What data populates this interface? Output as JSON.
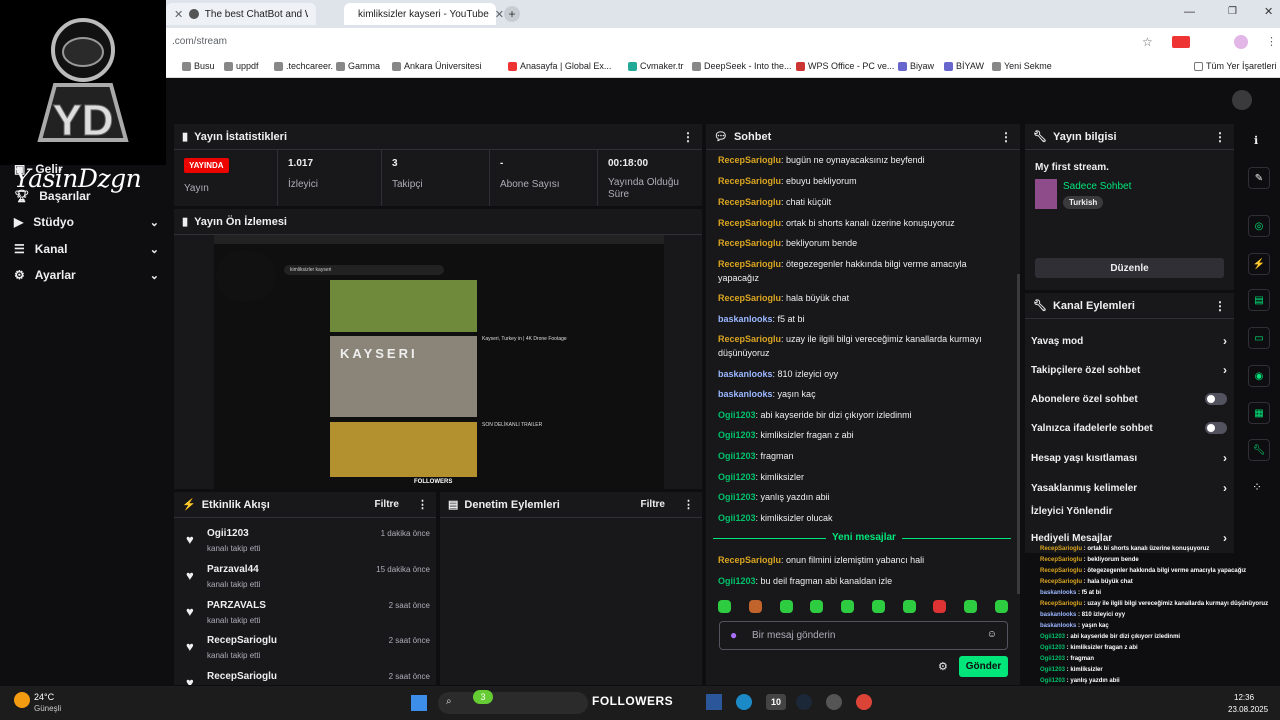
{
  "browser": {
    "tabs": [
      {
        "label": "The best ChatBot and Widgets"
      },
      {
        "label": "kimliksizler kayseri - YouTube"
      }
    ],
    "url": ".com/stream",
    "bookmarks": [
      "Busu",
      "uppdf",
      ".techcareer.",
      "Gamma",
      "Ankara Üniversitesi",
      "Anasayfa | Global Ex...",
      "Cvmaker.tr",
      "DeepSeek - Into the...",
      "WPS Office - PC ve...",
      "Biyaw",
      "BİYAW",
      "Yeni Sekme",
      "Tüm Yer İşaretleri"
    ]
  },
  "brand": {
    "name": "YasinDzgn",
    "logo_text": "YD"
  },
  "nav": [
    {
      "label": "Gelir",
      "icon": "money-icon"
    },
    {
      "label": "Başarılar",
      "icon": "trophy-icon"
    },
    {
      "label": "Stüdyo",
      "icon": "studio-icon"
    },
    {
      "label": "Kanal",
      "icon": "channel-icon"
    },
    {
      "label": "Ayarlar",
      "icon": "gear-icon"
    }
  ],
  "stats": {
    "title": "Yayın İstatistikleri",
    "live_badge": "YAYINDA",
    "live_label": "Yayın",
    "viewers_value": "1.017",
    "viewers_label": "İzleyici",
    "followers_value": "3",
    "followers_label": "Takipçi",
    "subs_value": "-",
    "subs_label": "Abone Sayısı",
    "time_value": "00:18:00",
    "time_label": "Yayında Olduğu Süre"
  },
  "preview": {
    "title": "Yayın Ön İzlemesi",
    "search_text": "kimliksizler kayseri",
    "video_title_1": "KAYSERI",
    "video_desc_1": "Kayseri, Turkey in | 4K Drone Footage",
    "video_title_2": "SON DELİKANLI TRAILER",
    "followers_overlay": "FOLLOWERS"
  },
  "activity": {
    "title": "Etkinlik Akışı",
    "filter": "Filtre",
    "items": [
      {
        "name": "Ogii1203",
        "sub": "kanalı takip etti",
        "time": "1 dakika önce"
      },
      {
        "name": "Parzaval44",
        "sub": "kanalı takip etti",
        "time": "15 dakika önce"
      },
      {
        "name": "PARZAVALS",
        "sub": "kanalı takip etti",
        "time": "2 saat önce"
      },
      {
        "name": "RecepSarioglu",
        "sub": "kanalı takip etti",
        "time": "2 saat önce"
      },
      {
        "name": "RecepSarioglu",
        "sub": "",
        "time": "2 saat önce"
      }
    ]
  },
  "moderation": {
    "title": "Denetim Eylemleri",
    "filter": "Filtre"
  },
  "chat": {
    "title": "Sohbet",
    "messages": [
      {
        "user": "RecepSarioglu",
        "text": "bugün ne oynayacaksınız beyfendi",
        "c": "u1"
      },
      {
        "user": "RecepSarioglu",
        "text": "ebuyu bekliyorum",
        "c": "u1"
      },
      {
        "user": "RecepSarioglu",
        "text": "chati küçült",
        "c": "u1"
      },
      {
        "user": "RecepSarioglu",
        "text": "ortak bi shorts kanalı üzerine konuşuyoruz",
        "c": "u1"
      },
      {
        "user": "RecepSarioglu",
        "text": "bekliyorum bende",
        "c": "u1"
      },
      {
        "user": "RecepSarioglu",
        "text": "ötegezegenler hakkında bilgi verme amacıyla yapacağız",
        "c": "u1"
      },
      {
        "user": "RecepSarioglu",
        "text": "hala büyük chat",
        "c": "u1"
      },
      {
        "user": "baskanlooks",
        "text": "f5 at bi",
        "c": "u2"
      },
      {
        "user": "RecepSarioglu",
        "text": "uzay ile ilgili bilgi vereceğimiz kanallarda kurmayı düşünüyoruz",
        "c": "u1"
      },
      {
        "user": "baskanlooks",
        "text": "810 izleyici oyy",
        "c": "u2"
      },
      {
        "user": "baskanlooks",
        "text": "yaşın kaç",
        "c": "u2"
      },
      {
        "user": "Ogii1203",
        "text": "abi kayseride bir dizi çıkıyorr izledinmi",
        "c": "u3"
      },
      {
        "user": "Ogii1203",
        "text": "kimliksizler fragan z abi",
        "c": "u3"
      },
      {
        "user": "Ogii1203",
        "text": "fragman",
        "c": "u3"
      },
      {
        "user": "Ogii1203",
        "text": "kimliksizler",
        "c": "u3"
      },
      {
        "user": "Ogii1203",
        "text": "yanlış yazdın abii",
        "c": "u3"
      },
      {
        "user": "Ogii1203",
        "text": "kimliksizler olucak",
        "c": "u3"
      }
    ],
    "new_messages_label": "Yeni mesajlar",
    "new_messages": [
      {
        "user": "RecepSarioglu",
        "text": "onun filmini izlemiştim yabancı hali",
        "c": "u1"
      },
      {
        "user": "Ogii1203",
        "text": "bu deil fragman abi kanaldan izle",
        "c": "u3"
      }
    ],
    "input_placeholder": "Bir mesaj gönderin",
    "send_label": "Gönder"
  },
  "stream_info": {
    "title": "Yayın bilgisi",
    "stream_title": "My first stream.",
    "category": "Sadece Sohbet",
    "tag": "Turkish",
    "edit_label": "Düzenle"
  },
  "channel_actions": {
    "title": "Kanal Eylemleri",
    "items": [
      {
        "label": "Yavaş mod",
        "kind": "arrow"
      },
      {
        "label": "Takipçilere özel sohbet",
        "kind": "arrow"
      },
      {
        "label": "Abonelere özel sohbet",
        "kind": "toggle"
      },
      {
        "label": "Yalnızca ifadelerle sohbet",
        "kind": "toggle"
      },
      {
        "label": "Hesap yaşı kısıtlaması",
        "kind": "arrow"
      },
      {
        "label": "Yasaklanmış kelimeler",
        "kind": "arrow"
      },
      {
        "label": "İzleyici Yönlendir",
        "kind": "none"
      },
      {
        "label": "Hediyeli Mesajlar",
        "kind": "arrow"
      }
    ]
  },
  "overlay_chat": [
    {
      "user": "RecepSarioglu",
      "text": "ortak bi shorts kanalı üzerine konuşuyoruz",
      "c": ""
    },
    {
      "user": "RecepSarioglu",
      "text": "bekliyorum bende",
      "c": ""
    },
    {
      "user": "RecepSarioglu",
      "text": "ötegezegenler hakkında bilgi verme amacıyla yapacağız",
      "c": ""
    },
    {
      "user": "RecepSarioglu",
      "text": "hala büyük chat",
      "c": ""
    },
    {
      "user": "baskanlooks",
      "text": "f5 at bi",
      "c": "b"
    },
    {
      "user": "RecepSarioglu",
      "text": "uzay ile ilgili bilgi vereceğimiz kanallarda kurmayı düşünüyoruz",
      "c": ""
    },
    {
      "user": "baskanlooks",
      "text": "810 izleyici oyy",
      "c": "b"
    },
    {
      "user": "baskanlooks",
      "text": "yaşın kaç",
      "c": "b"
    },
    {
      "user": "Ogii1203",
      "text": "abi kayseride bir dizi çıkıyorr izledinmi",
      "c": "g"
    },
    {
      "user": "Ogii1203",
      "text": "kimliksizler fragan z abi",
      "c": "g"
    },
    {
      "user": "Ogii1203",
      "text": "fragman",
      "c": "g"
    },
    {
      "user": "Ogii1203",
      "text": "kimliksizler",
      "c": "g"
    },
    {
      "user": "Ogii1203",
      "text": "yanlış yazdın abii",
      "c": "g"
    },
    {
      "user": "Ogii1203",
      "text": "kimliksizler olucak",
      "c": "g"
    },
    {
      "user": "RecepSarioglu",
      "text": "onun filmini izlemiştim yabancı hali",
      "c": ""
    },
    {
      "user": "Ogii1203",
      "text": "bu deil fragman abi kanaldan izle",
      "c": "g"
    }
  ],
  "taskbar": {
    "weather_temp": "24°C",
    "weather_desc": "Güneşli",
    "search_badge": "3",
    "followers_text": "FOLLOWERS",
    "badge_count": "10",
    "time": "12:36",
    "date": "23.08.2025"
  }
}
